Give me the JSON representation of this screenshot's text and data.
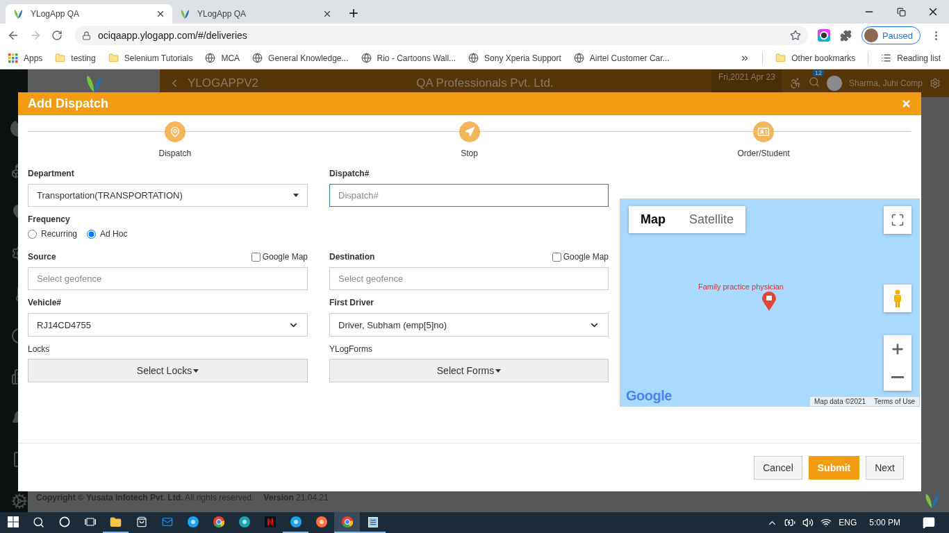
{
  "browser": {
    "tabs": [
      {
        "title": "YLogApp QA",
        "selected": true
      },
      {
        "title": "YLogApp QA",
        "selected": false
      }
    ],
    "url": "ociqaapp.ylogapp.com/#/deliveries",
    "profile": "Paused",
    "bookmarks": [
      {
        "kind": "apps",
        "label": "Apps"
      },
      {
        "kind": "folder",
        "label": "testing"
      },
      {
        "kind": "folder",
        "label": "Selenium Tutorials"
      },
      {
        "kind": "globe",
        "label": "MCA"
      },
      {
        "kind": "globe",
        "label": "General Knowledge..."
      },
      {
        "kind": "globe",
        "label": "Rio - Cartoons Wall..."
      },
      {
        "kind": "globe",
        "label": "Sony Xperia Support"
      },
      {
        "kind": "globe",
        "label": "Airtel Customer Car..."
      }
    ],
    "other_bookmarks": "Other bookmarks",
    "reading_list": "Reading list"
  },
  "app": {
    "brand": "YLOGAPPV2",
    "company": "QA Professionals Pvt. Ltd.",
    "date": "Fri,2021 Apr 23",
    "badge": "12",
    "user": "Sharma, Juhi Comp",
    "copyright": "**Copyright © Yusata Infotech Pvt. Ltd.** All rights reserved.",
    "version": "**Version** 21.04.21"
  },
  "dialog": {
    "title": "Add Dispatch",
    "steps": [
      {
        "label": "Dispatch",
        "kind": "pin"
      },
      {
        "label": "Stop",
        "kind": "navigate"
      },
      {
        "label": "Order/Student",
        "kind": "card"
      }
    ],
    "department": {
      "label": "Department",
      "value": "Transportation(TRANSPORTATION)"
    },
    "dispatch_no": {
      "label": "Dispatch#",
      "placeholder": "Dispatch#"
    },
    "frequency": {
      "label": "Frequency",
      "options": [
        {
          "label": "Recurring",
          "selected": false
        },
        {
          "label": "Ad Hoc",
          "selected": true
        }
      ]
    },
    "source": {
      "label": "Source",
      "map_option": {
        "label": "Google Map",
        "checked": false
      },
      "placeholder": "Select geofence"
    },
    "destination": {
      "label": "Destination",
      "map_option": {
        "label": "Google Map",
        "checked": false
      },
      "placeholder": "Select geofence"
    },
    "vehicle": {
      "label": "Vehicle#",
      "value": "RJ14CD4755"
    },
    "first_driver": {
      "label": "First Driver",
      "value": "Driver, Subham (emp[5]no)"
    },
    "locks": {
      "label": "Locks",
      "button": "Select Locks"
    },
    "forms": {
      "label": "YLogForms",
      "button": "Select Forms"
    },
    "map": {
      "map_types": [
        {
          "label": "Map",
          "selected": true
        },
        {
          "label": "Satellite",
          "selected": false
        }
      ],
      "place": "Family practice physician",
      "logo": "Google",
      "attribution": "Map data ©2021",
      "terms": "Terms of Use"
    },
    "buttons": [
      {
        "label": "Cancel",
        "kind": "default"
      },
      {
        "label": "Submit",
        "kind": "primary"
      },
      {
        "label": "Next",
        "kind": "default"
      }
    ]
  },
  "taskbar": {
    "apps": [
      {
        "kind": "folder",
        "open": true,
        "selected": false
      },
      {
        "kind": "store",
        "open": false,
        "selected": false
      },
      {
        "kind": "mail",
        "open": false,
        "selected": false
      },
      {
        "kind": "skype",
        "open": false,
        "selected": false
      },
      {
        "kind": "chrome",
        "open": false,
        "selected": false
      },
      {
        "kind": "edge",
        "open": false,
        "selected": false
      },
      {
        "kind": "netflix",
        "open": false,
        "selected": false
      },
      {
        "kind": "skype",
        "open": true,
        "selected": false
      },
      {
        "kind": "firefox",
        "open": false,
        "selected": false
      },
      {
        "kind": "chrome",
        "open": true,
        "selected": true
      },
      {
        "kind": "notepad",
        "open": true,
        "selected": false
      }
    ],
    "language": "ENG",
    "time": "5:00 PM"
  }
}
